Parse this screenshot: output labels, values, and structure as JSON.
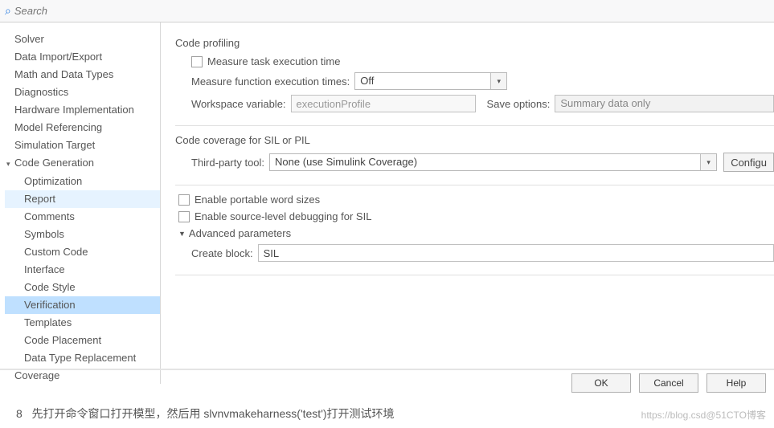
{
  "search": {
    "placeholder": "Search"
  },
  "sidebar": {
    "items": [
      {
        "label": "Solver",
        "level": "top"
      },
      {
        "label": "Data Import/Export",
        "level": "top"
      },
      {
        "label": "Math and Data Types",
        "level": "top"
      },
      {
        "label": "Diagnostics",
        "level": "top"
      },
      {
        "label": "Hardware Implementation",
        "level": "top"
      },
      {
        "label": "Model Referencing",
        "level": "top"
      },
      {
        "label": "Simulation Target",
        "level": "top"
      },
      {
        "label": "Code Generation",
        "level": "top expanded"
      },
      {
        "label": "Optimization",
        "level": "child"
      },
      {
        "label": "Report",
        "level": "child-report"
      },
      {
        "label": "Comments",
        "level": "child"
      },
      {
        "label": "Symbols",
        "level": "child"
      },
      {
        "label": "Custom Code",
        "level": "child"
      },
      {
        "label": "Interface",
        "level": "child"
      },
      {
        "label": "Code Style",
        "level": "child"
      },
      {
        "label": "Verification",
        "level": "child-selected"
      },
      {
        "label": "Templates",
        "level": "child"
      },
      {
        "label": "Code Placement",
        "level": "child"
      },
      {
        "label": "Data Type Replacement",
        "level": "child"
      },
      {
        "label": "Coverage",
        "level": "top"
      }
    ]
  },
  "profiling": {
    "title": "Code profiling",
    "measure_task": "Measure task execution time",
    "measure_fn_label": "Measure function execution times:",
    "measure_fn_value": "Off",
    "ws_var_label": "Workspace variable:",
    "ws_var_value": "executionProfile",
    "save_label": "Save options:",
    "save_value": "Summary data only"
  },
  "coverage": {
    "title": "Code coverage for SIL or PIL",
    "tool_label": "Third-party tool:",
    "tool_value": "None (use Simulink Coverage)",
    "config_btn": "Configu"
  },
  "opts": {
    "portable": "Enable portable word sizes",
    "debug": "Enable source-level debugging for SIL"
  },
  "advanced": {
    "title": "Advanced parameters",
    "create_block_label": "Create block:",
    "create_block_value": "SIL"
  },
  "buttons": {
    "ok": "OK",
    "cancel": "Cancel",
    "help": "Help"
  },
  "footer": {
    "index": "8",
    "text": "先打开命令窗口打开模型，然后用 slvnvmakeharness('test')打开测试环境",
    "watermark": "https://blog.csd@51CTO博客"
  }
}
